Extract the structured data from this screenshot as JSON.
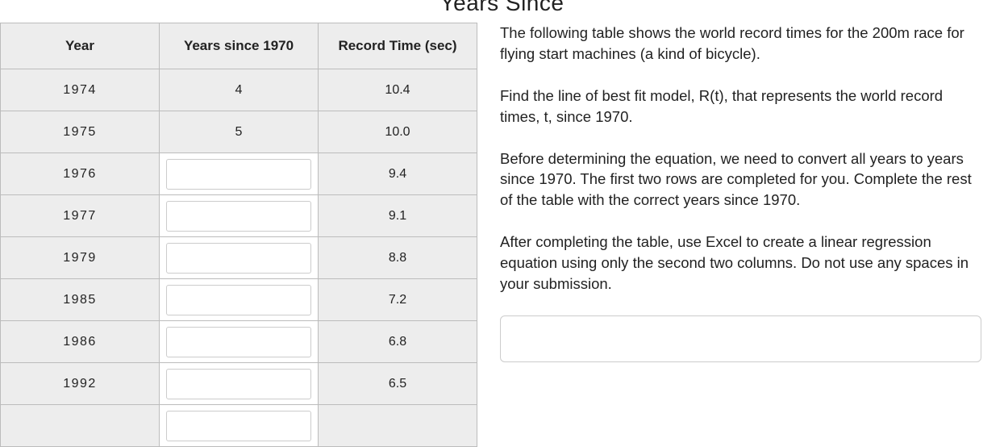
{
  "title_partial": "Years Since",
  "table": {
    "headers": [
      "Year",
      "Years since 1970",
      "Record Time (sec)"
    ],
    "rows": [
      {
        "year": "1974",
        "since": "4",
        "time": "10.4",
        "editable": false
      },
      {
        "year": "1975",
        "since": "5",
        "time": "10.0",
        "editable": false
      },
      {
        "year": "1976",
        "since": "",
        "time": "9.4",
        "editable": true
      },
      {
        "year": "1977",
        "since": "",
        "time": "9.1",
        "editable": true
      },
      {
        "year": "1979",
        "since": "",
        "time": "8.8",
        "editable": true
      },
      {
        "year": "1985",
        "since": "",
        "time": "7.2",
        "editable": true
      },
      {
        "year": "1986",
        "since": "",
        "time": "6.8",
        "editable": true
      },
      {
        "year": "1992",
        "since": "",
        "time": "6.5",
        "editable": true
      },
      {
        "year": "",
        "since": "",
        "time": "",
        "editable": true
      }
    ]
  },
  "paragraphs": {
    "p1": "The following table shows the world record times for the 200m race for flying start machines (a kind of bicycle).",
    "p2": "Find the line of best fit model, R(t), that represents the world record times, t, since 1970.",
    "p3": "Before determining the equation, we need to convert all years to years since 1970. The first two rows are completed for you. Complete the rest of the table with the correct years since 1970.",
    "p4": "After completing the table, use Excel to create a linear regression equation using only the second two columns. Do not use any spaces in your submission."
  },
  "answer_value": "",
  "chart_data": {
    "type": "table",
    "title": "Years Since",
    "columns": [
      "Year",
      "Years since 1970",
      "Record Time (sec)"
    ],
    "rows": [
      [
        1974,
        4,
        10.4
      ],
      [
        1975,
        5,
        10.0
      ],
      [
        1976,
        null,
        9.4
      ],
      [
        1977,
        null,
        9.1
      ],
      [
        1979,
        null,
        8.8
      ],
      [
        1985,
        null,
        7.2
      ],
      [
        1986,
        null,
        6.8
      ],
      [
        1992,
        null,
        6.5
      ]
    ]
  }
}
